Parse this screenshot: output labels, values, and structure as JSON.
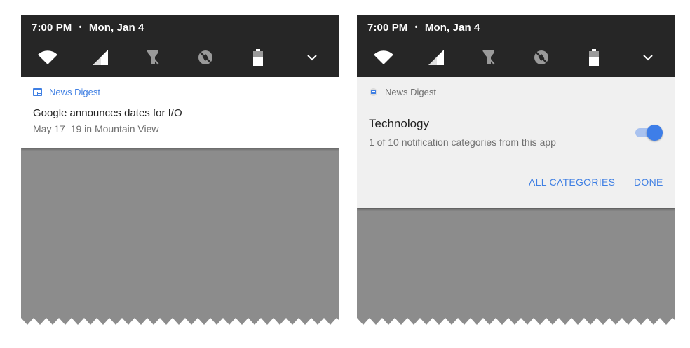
{
  "status_bar": {
    "time": "7:00 PM",
    "separator": "•",
    "date": "Mon, Jan 4",
    "quick_settings": [
      "wifi-icon",
      "cellular-signal-icon",
      "flashlight-off-icon",
      "auto-rotate-off-icon",
      "battery-icon",
      "chevron-down-icon"
    ]
  },
  "left_notification": {
    "app_name": "News Digest",
    "title": "Google announces dates for I/O",
    "text": "May 17–19 in Mountain View"
  },
  "right_notification": {
    "app_name": "News Digest",
    "category_title": "Technology",
    "category_subtitle": "1 of 10 notification categories from this app",
    "toggle_on": true,
    "all_categories_label": "ALL CATEGORIES",
    "done_label": "DONE"
  },
  "colors": {
    "status_bar_bg": "#262626",
    "accent_blue": "#3f7fe3",
    "background_gray": "#8c8c8c"
  }
}
